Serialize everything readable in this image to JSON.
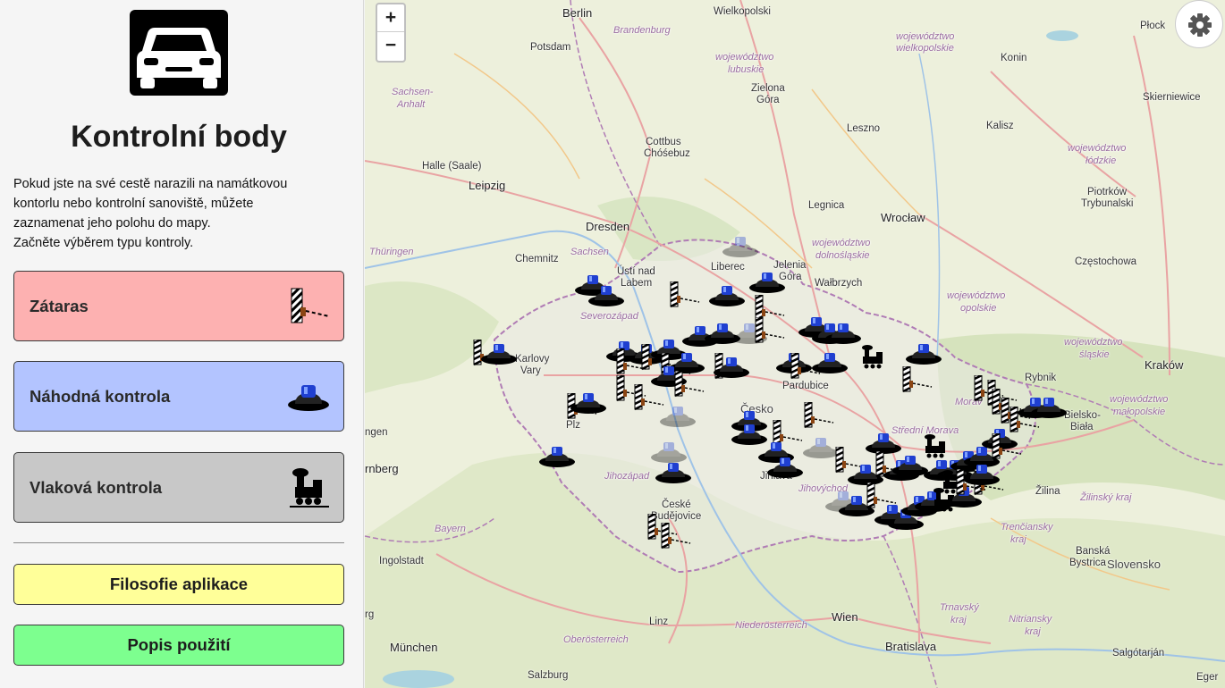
{
  "sidebar": {
    "logo_icon": "car-front-icon",
    "title": "Kontrolní body",
    "intro_lines": [
      "Pokud jste na své cestě narazili na namátkovou",
      "kontorlu nebo kontrolní sanoviště, můžete",
      "zaznamenat jeho polohu do mapy.",
      "Začněte výběrem typu kontroly."
    ],
    "buttons": [
      {
        "label": "Zátaras",
        "icon": "roadblock-barrier-icon",
        "color": "#fdb1b1"
      },
      {
        "label": "Náhodná kontrola",
        "icon": "police-hat-icon",
        "color": "#b3c4ff"
      },
      {
        "label": "Vlaková kontrola",
        "icon": "train-icon",
        "color": "#c8c8c8"
      }
    ],
    "info_buttons": [
      {
        "label": "Filosofie aplikace",
        "color": "#ffff99"
      },
      {
        "label": "Popis použití",
        "color": "#7dff8f"
      }
    ]
  },
  "map": {
    "zoom_in": "+",
    "zoom_out": "−",
    "settings_icon": "gear-icon",
    "labels": [
      {
        "text": "Berlin"
      },
      {
        "text": "Brandenburg"
      },
      {
        "text": "Potsdam"
      },
      {
        "text": "Wielkopolski"
      },
      {
        "text": "województwo"
      },
      {
        "text": "wielkopolskie"
      },
      {
        "text": "Płock"
      },
      {
        "text": "Konin"
      },
      {
        "text": "Skierniewice"
      },
      {
        "text": "województwo"
      },
      {
        "text": "lubuskie"
      },
      {
        "text": "Zielona"
      },
      {
        "text": "Góra"
      },
      {
        "text": "Sachsen-"
      },
      {
        "text": "Anhalt"
      },
      {
        "text": "Leszno"
      },
      {
        "text": "Kalisz"
      },
      {
        "text": "Cottbus"
      },
      {
        "text": "Chóśebuz"
      },
      {
        "text": "województwo"
      },
      {
        "text": "łódzkie"
      },
      {
        "text": "Halle (Saale)"
      },
      {
        "text": "Leipzig"
      },
      {
        "text": "Piotrków"
      },
      {
        "text": "Trybunalski"
      },
      {
        "text": "Legnica"
      },
      {
        "text": "Wrocław"
      },
      {
        "text": "Dresden"
      },
      {
        "text": "Thüringen"
      },
      {
        "text": "Chemnitz"
      },
      {
        "text": "Sachsen"
      },
      {
        "text": "Liberec"
      },
      {
        "text": "Jelenia"
      },
      {
        "text": "Góra"
      },
      {
        "text": "województwo"
      },
      {
        "text": "dolnośląskie"
      },
      {
        "text": "Częstochowa"
      },
      {
        "text": "Ústí nad"
      },
      {
        "text": "Labem"
      },
      {
        "text": "Wałbrzych"
      },
      {
        "text": "województwo"
      },
      {
        "text": "opolskie"
      },
      {
        "text": "Severozápad"
      },
      {
        "text": "województwo"
      },
      {
        "text": "śląskie"
      },
      {
        "text": "Karlovy"
      },
      {
        "text": "Vary"
      },
      {
        "text": "Kraków"
      },
      {
        "text": "Rybnik"
      },
      {
        "text": "Pardubice"
      },
      {
        "text": "Morav"
      },
      {
        "text": "województwo"
      },
      {
        "text": "małopolskie"
      },
      {
        "text": "ngen"
      },
      {
        "text": "Plz"
      },
      {
        "text": "Česko"
      },
      {
        "text": "Bielsko-"
      },
      {
        "text": "Biała"
      },
      {
        "text": "Střední Morava"
      },
      {
        "text": "rnberg"
      },
      {
        "text": "Jihozápad"
      },
      {
        "text": "Jihlava"
      },
      {
        "text": "Jihovýchod"
      },
      {
        "text": "Žilina"
      },
      {
        "text": "Žilinský kraj"
      },
      {
        "text": "České"
      },
      {
        "text": "Budějovice"
      },
      {
        "text": "Bayern"
      },
      {
        "text": "Trenčiansky"
      },
      {
        "text": "kraj"
      },
      {
        "text": "Ingolstadt"
      },
      {
        "text": "Banská"
      },
      {
        "text": "Bystrica"
      },
      {
        "text": "Slovensko"
      },
      {
        "text": "rg"
      },
      {
        "text": "Linz"
      },
      {
        "text": "Wien"
      },
      {
        "text": "Trnavský"
      },
      {
        "text": "kraj"
      },
      {
        "text": "Nitriansky"
      },
      {
        "text": "kraj"
      },
      {
        "text": "Niederösterreich"
      },
      {
        "text": "München"
      },
      {
        "text": "Oberösterreich"
      },
      {
        "text": "Bratislava"
      },
      {
        "text": "Salzburg"
      },
      {
        "text": "Salgótarján"
      },
      {
        "text": "Eger"
      }
    ],
    "markers": [
      {
        "type": "police-hat-icon"
      }
    ]
  }
}
